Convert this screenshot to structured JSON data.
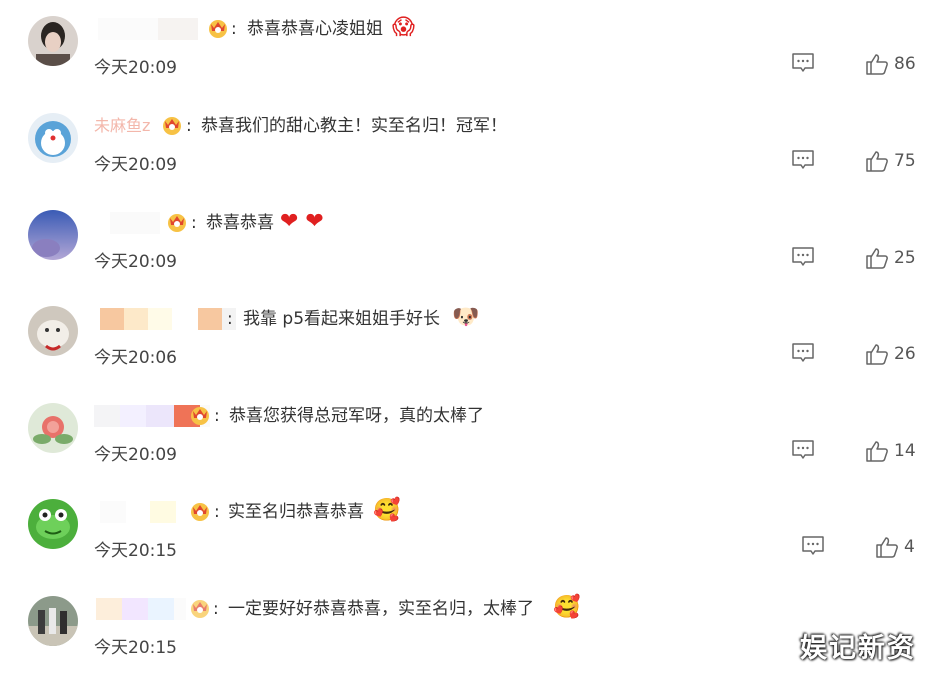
{
  "comments": [
    {
      "name_tail": "",
      "colon": ":",
      "text": "恭喜恭喜心凌姐姐",
      "emoji": "😱",
      "time": "今天20:09",
      "likes": "86"
    },
    {
      "name_tail": "未麻鱼z",
      "colon": ":",
      "text": "恭喜我们的甜心教主！实至名归！冠军！",
      "emoji": "",
      "time": "今天20:09",
      "likes": "75"
    },
    {
      "name_tail": "",
      "colon": ":",
      "text": "恭喜恭喜",
      "emoji": "❤ ❤",
      "time": "今天20:09",
      "likes": "25"
    },
    {
      "name_tail": "",
      "colon": ":",
      "text": "我靠 p5看起来姐姐手好长",
      "emoji": "🐶",
      "time": "今天20:06",
      "likes": "26"
    },
    {
      "name_tail": "",
      "colon": ":",
      "text": "恭喜您获得总冠军呀，真的太棒了",
      "emoji": "",
      "time": "今天20:09",
      "likes": "14"
    },
    {
      "name_tail": "",
      "colon": ":",
      "text": "实至名归恭喜恭喜",
      "emoji": "🥰",
      "time": "今天20:15",
      "likes": "4"
    },
    {
      "name_tail": "",
      "colon": ":",
      "text": "一定要好好恭喜恭喜，实至名归，太棒了",
      "emoji": "🥰",
      "time": "今天20:15",
      "likes": ""
    }
  ],
  "watermark": "娱记新资",
  "colors": {
    "like_icon": "#666666",
    "reply_icon": "#666666",
    "badge_gold": "#f0a500",
    "heart": "#e02020"
  },
  "icons": {
    "reply": "comment-bubble-icon",
    "like": "thumbs-up-icon",
    "badge": "crown-badge-icon"
  }
}
